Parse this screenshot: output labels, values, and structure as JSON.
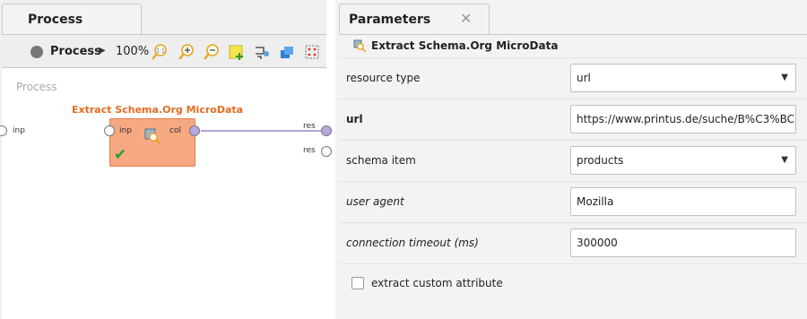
{
  "process_panel": {
    "tab_label": "Process",
    "breadcrumb": "Process",
    "zoom": "100%",
    "canvas_title": "Process",
    "operator": {
      "title": "Extract Schema.Org MicroData",
      "input_port": "inp",
      "output_port": "col"
    },
    "left_port": "inp",
    "right_ports": [
      "res",
      "res"
    ]
  },
  "params_panel": {
    "tab_label": "Parameters",
    "operator_name": "Extract Schema.Org MicroData",
    "params": [
      {
        "label": "resource type",
        "value": "url"
      },
      {
        "label": "url",
        "value": "https://www.printus.de/suche/B%C3%BC"
      },
      {
        "label": "schema item",
        "value": "products"
      },
      {
        "label": "user agent",
        "value": "Mozilla"
      },
      {
        "label": "connection timeout (ms)",
        "value": "300000"
      }
    ],
    "checkbox": {
      "label": "extract custom attribute",
      "checked": false
    }
  },
  "colors": {
    "operator_fill": "#f5a882",
    "operator_title": "#e56b1f",
    "connection_line": "#9a86c9"
  }
}
